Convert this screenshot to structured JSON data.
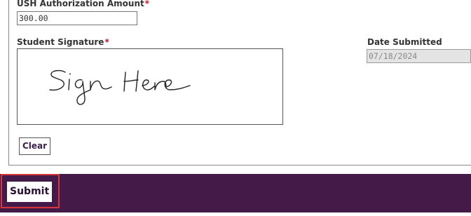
{
  "form": {
    "amount_label": "USH Authorization Amount",
    "amount_value": "300.00",
    "signature_label": "Student Signature",
    "signature_placeholder_text": "Sign Here",
    "date_label": "Date Submitted",
    "date_value": "07/18/2024",
    "required_marker": "*",
    "clear_label": "Clear"
  },
  "footer": {
    "submit_label": "Submit"
  },
  "colors": {
    "footer_bg": "#431a48",
    "required": "#c0162c",
    "highlight": "#d9343a"
  }
}
